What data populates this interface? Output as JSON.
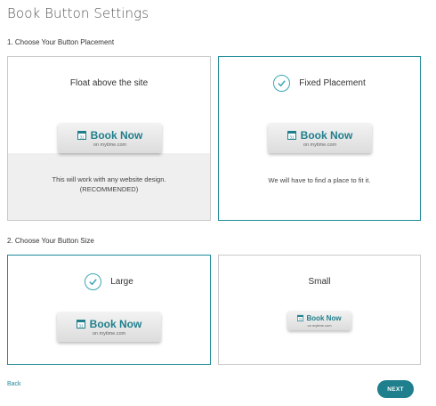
{
  "page": {
    "title": "Book Button Settings"
  },
  "placement": {
    "section_title": "1. Choose Your Button Placement",
    "options": [
      {
        "label": "Float above the site",
        "description_line1": "This will work with any website design.",
        "description_line2": "(RECOMMENDED)",
        "selected": false
      },
      {
        "label": "Fixed Placement",
        "description_line1": "We will have to find a place to fit it.",
        "selected": true
      }
    ]
  },
  "size": {
    "section_title": "2. Choose Your Button Size",
    "options": [
      {
        "label": "Large",
        "selected": true
      },
      {
        "label": "Small",
        "selected": false
      }
    ]
  },
  "book_button": {
    "label": "Book Now",
    "sublabel": "on mytime.com",
    "icon": "calendar-icon",
    "calendar_day": "31"
  },
  "footer": {
    "back_label": "Back",
    "next_label": "NEXT"
  },
  "colors": {
    "accent": "#1f8a98",
    "button_text": "#1f7f8c",
    "border": "#c9c9c9",
    "band": "#efefef"
  }
}
